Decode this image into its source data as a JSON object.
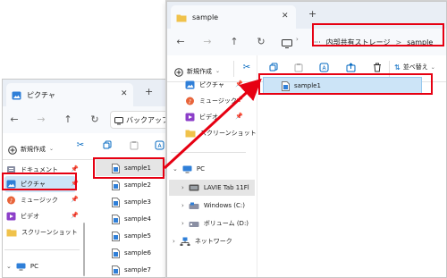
{
  "window1": {
    "tab_title": "ピクチャ",
    "address_text": "バックアップの",
    "new_label": "新規作成",
    "sidebar": {
      "items": [
        {
          "label": "ドキュメント",
          "icon": "document-folder-icon"
        },
        {
          "label": "ピクチャ",
          "icon": "pictures-folder-icon"
        },
        {
          "label": "ミュージック",
          "icon": "music-folder-icon"
        },
        {
          "label": "ビデオ",
          "icon": "video-folder-icon"
        },
        {
          "label": "スクリーンショット",
          "icon": "folder-icon"
        }
      ],
      "pc_label": "PC"
    },
    "files": [
      "sample1",
      "sample2",
      "sample3",
      "sample4",
      "sample5",
      "sample6",
      "sample7"
    ]
  },
  "window2": {
    "tab_title": "sample",
    "breadcrumb": {
      "ellipsis": "···",
      "parts": [
        "内部共有ストレージ",
        "sample"
      ],
      "separator": ">"
    },
    "new_label": "新規作成",
    "sort_label": "並べ替え",
    "sidebar": {
      "items": [
        {
          "label": "ピクチャ",
          "icon": "pictures-folder-icon"
        },
        {
          "label": "ミュージック",
          "icon": "music-folder-icon"
        },
        {
          "label": "ビデオ",
          "icon": "video-folder-icon"
        },
        {
          "label": "スクリーンショット",
          "icon": "folder-icon"
        }
      ],
      "pc_label": "PC",
      "devices": [
        "LAVIE Tab 11Fl",
        "Windows (C:)",
        "ボリューム (D:)",
        "ネットワーク"
      ]
    },
    "files": [
      "sample1"
    ]
  },
  "colors": {
    "highlight": "#e60012",
    "selection": "#cce4f7",
    "folder": "#f0c24b",
    "accent": "#0067c0"
  }
}
